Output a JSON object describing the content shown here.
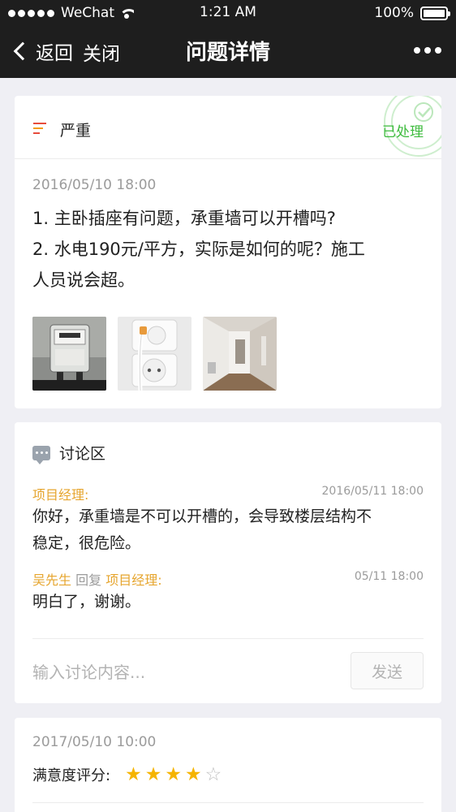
{
  "status_bar": {
    "carrier": "WeChat",
    "time": "1:21 AM",
    "battery": "100%"
  },
  "nav": {
    "back_label": "返回",
    "close_label": "关闭",
    "title": "问题详情"
  },
  "issue": {
    "severity": "严重",
    "status": "已处理",
    "date": "2016/05/10 18:00",
    "lines": [
      "1. 主卧插座有问题，承重墙可以开槽吗?",
      "2. 水电190元/平方，实际是如何的呢？施工",
      "人员说会超。"
    ],
    "images": [
      "electric-meter-photo",
      "wall-socket-photo",
      "hallway-photo"
    ]
  },
  "discussion": {
    "title": "讨论区",
    "comments": [
      {
        "author": "项目经理:",
        "date": "2016/05/11 18:00",
        "lines": [
          "你好，承重墙是不可以开槽的，会导致楼层结构不",
          "稳定，很危险。"
        ]
      },
      {
        "author": "吴先生",
        "reply_word": "回复",
        "reply_to": "项目经理:",
        "date": "05/11 18:00",
        "lines": [
          "明白了，谢谢。"
        ]
      }
    ],
    "input_placeholder": "输入讨论内容...",
    "send_label": "发送"
  },
  "review": {
    "date": "2017/05/10 10:00",
    "label": "满意度评分:",
    "rating": 4,
    "max_rating": 5
  },
  "colors": {
    "accent_orange": "#e6a52e",
    "success_green": "#3dbb3d",
    "severity_red": "#e74c3c",
    "star": "#f5b400"
  }
}
